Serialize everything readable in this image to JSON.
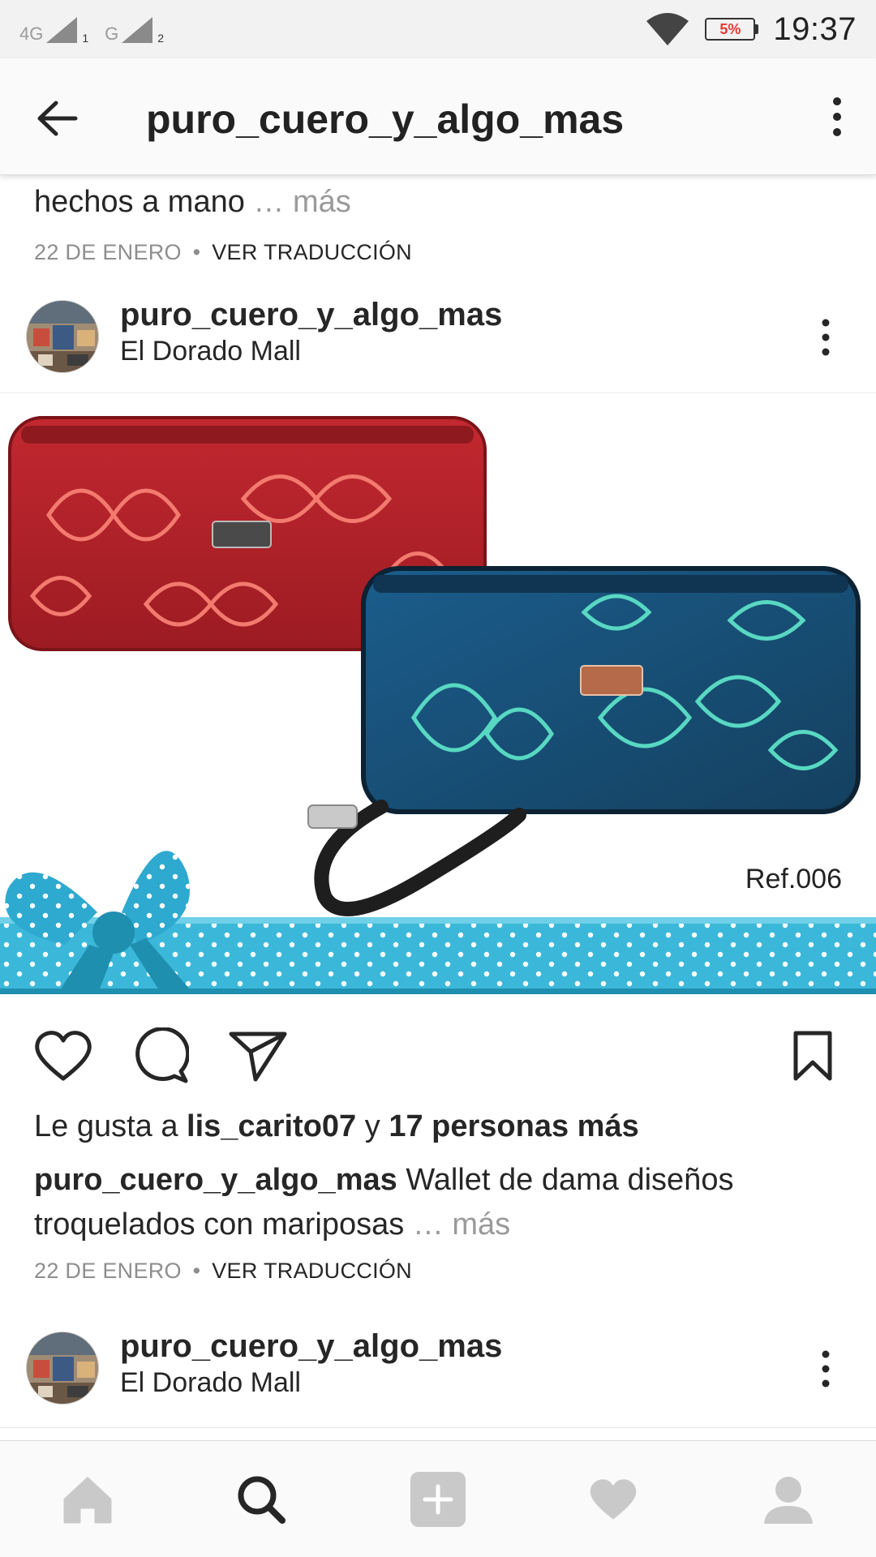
{
  "status_bar": {
    "net1": "4G",
    "sim1": "1",
    "net2": "G",
    "sim2": "2",
    "battery": "5%",
    "time": "19:37"
  },
  "app_bar": {
    "title": "puro_cuero_y_algo_mas"
  },
  "previous_post": {
    "caption_tail": "hechos a mano",
    "more": "… más",
    "date": "22 DE ENERO",
    "separator": "•",
    "translate": "VER TRADUCCIÓN"
  },
  "post": {
    "username": "puro_cuero_y_algo_mas",
    "location": "El Dorado Mall",
    "image_text": "Ref.006",
    "likes_prefix": "Le gusta a",
    "likes_user": "lis_carito07",
    "likes_joiner": "y",
    "likes_count": "17 personas más",
    "caption_user": "puro_cuero_y_algo_mas",
    "caption_text": "Wallet de dama diseños troquelados con mariposas",
    "more": "… más",
    "date": "22 DE ENERO",
    "separator": "•",
    "translate": "VER TRADUCCIÓN"
  },
  "next_post": {
    "username": "puro_cuero_y_algo_mas",
    "location": "El Dorado Mall"
  },
  "colors": {
    "red_wallet": "#b8202a",
    "blue_wallet": "#1d4f7a",
    "ribbon": "#3bb8d9"
  }
}
